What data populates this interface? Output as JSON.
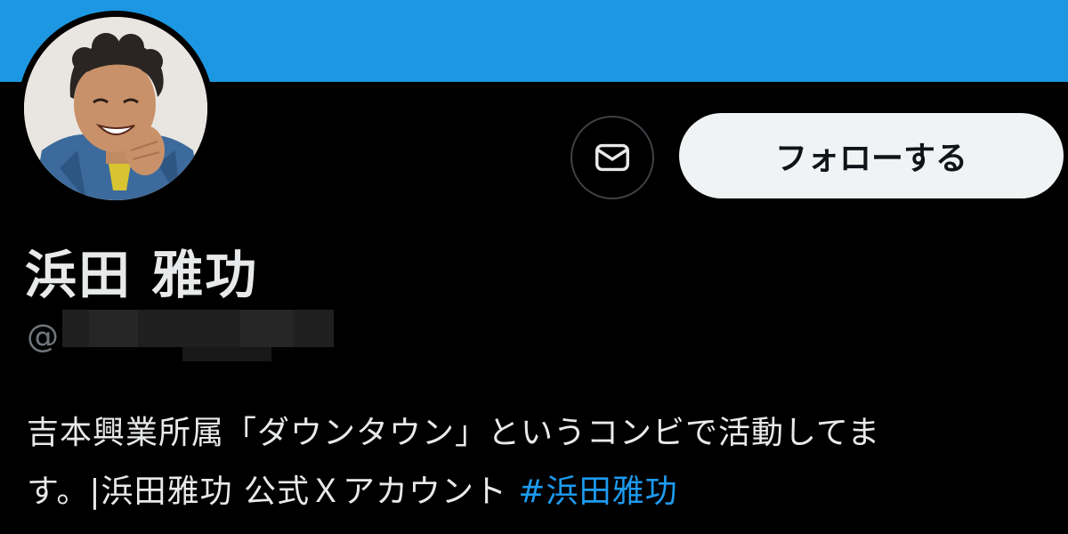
{
  "colors": {
    "banner": "#1d97e1",
    "background": "#000000",
    "text_primary": "#e7e9ea",
    "text_secondary": "#71767b",
    "link": "#1d9bf0",
    "follow_button_bg": "#eff3f4",
    "follow_button_text": "#0f1419"
  },
  "profile": {
    "display_name": "浜田 雅功",
    "handle_prefix": "@",
    "bio_text_1": "吉本興業所属「ダウンタウン」というコンビで活動してま",
    "bio_text_2": "す。|浜田雅功 公式Ｘアカウント ",
    "bio_hashtag": "#浜田雅功"
  },
  "actions": {
    "message_icon": "envelope-icon",
    "follow_label": "フォローする"
  }
}
